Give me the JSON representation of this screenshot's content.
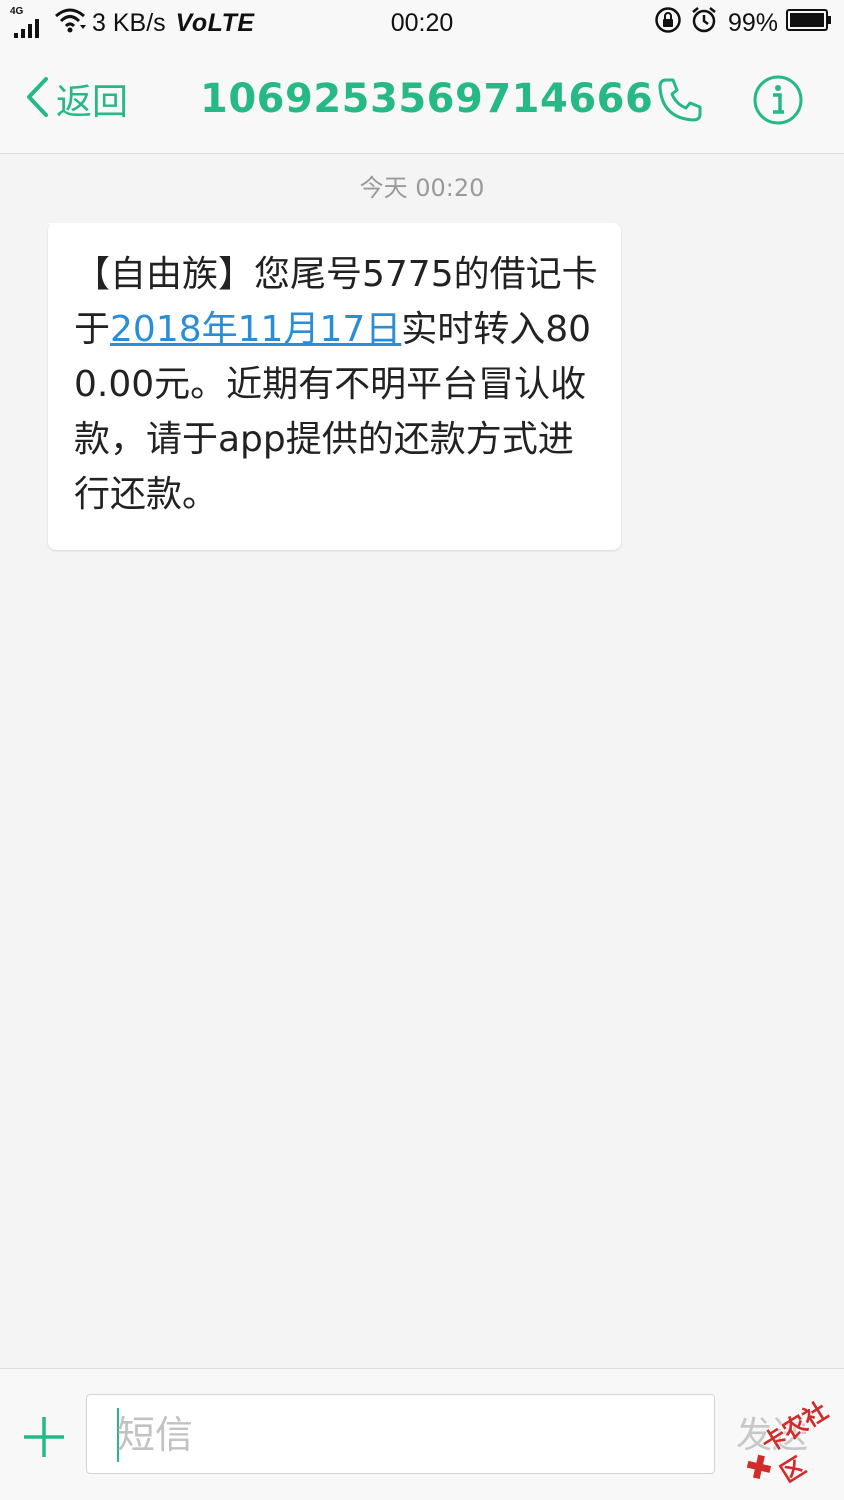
{
  "status_bar": {
    "network": "4G",
    "speed": "3 KB/s",
    "volte": "VoLTE",
    "time": "00:20",
    "battery": "99%",
    "icons": [
      "signal-icon",
      "wifi-icon",
      "rotation-lock-icon",
      "alarm-icon",
      "battery-icon"
    ]
  },
  "header": {
    "back_label": "返回",
    "title": "1069253569714666",
    "call_icon": "phone-icon",
    "info_icon": "info-icon"
  },
  "conversation": {
    "timestamp": "今天 00:20",
    "message": {
      "before": "【自由族】您尾号5775的借记卡于",
      "date_link": "2018年11月17日",
      "after": "实时转入800.00元。近期有不明平台冒认收款，请于app提供的还款方式进行还款。"
    }
  },
  "compose": {
    "add_icon": "plus-icon",
    "placeholder": "短信",
    "send_label": "发送"
  },
  "watermark": {
    "text": "卡农社区",
    "mark": "✖"
  },
  "colors": {
    "accent": "#26b885",
    "link": "#2a8ed6",
    "background": "#f4f4f4",
    "bar_background": "#f8f8f8",
    "bubble": "#ffffff",
    "watermark": "#d12b2b"
  }
}
